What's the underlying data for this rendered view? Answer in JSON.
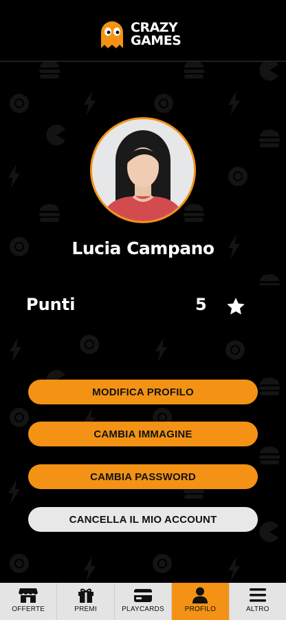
{
  "app": {
    "logo_top": "CRAZY",
    "logo_bottom": "GAMES"
  },
  "profile": {
    "name": "Lucia Campano",
    "points_label": "Punti",
    "points_value": "5"
  },
  "actions": {
    "edit_profile": "MODIFICA PROFILO",
    "change_image": "CAMBIA IMMAGINE",
    "change_password": "CAMBIA PASSWORD",
    "delete_account": "CANCELLA IL MIO ACCOUNT"
  },
  "tabs": [
    {
      "label": "OFFERTE",
      "icon": "store-icon",
      "active": false
    },
    {
      "label": "PREMI",
      "icon": "gift-icon",
      "active": false
    },
    {
      "label": "PLAYCARDS",
      "icon": "card-icon",
      "active": false
    },
    {
      "label": "PROFILO",
      "icon": "user-icon",
      "active": true
    },
    {
      "label": "ALTRO",
      "icon": "menu-icon",
      "active": false
    }
  ],
  "colors": {
    "accent": "#f39214",
    "background": "#000000",
    "tabbar": "#e4e4e4",
    "secondary_button": "#e8e8e8"
  }
}
